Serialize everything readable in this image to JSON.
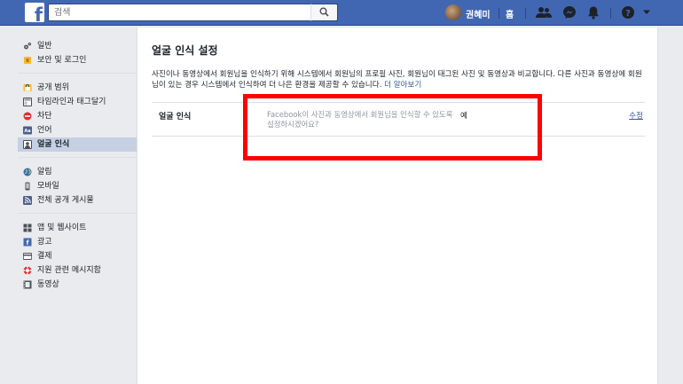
{
  "topbar": {
    "logo": "f",
    "search_placeholder": "검색",
    "user_name": "권혜미",
    "home_label": "홈"
  },
  "sidebar": {
    "groups": [
      {
        "items": [
          {
            "label": "일반",
            "icon": "gears-icon"
          },
          {
            "label": "보안 및 로그인",
            "icon": "shield-icon"
          }
        ]
      },
      {
        "items": [
          {
            "label": "공개 범위",
            "icon": "privacy-lock-icon"
          },
          {
            "label": "타임라인과 태그달기",
            "icon": "timeline-icon"
          },
          {
            "label": "차단",
            "icon": "block-icon"
          },
          {
            "label": "언어",
            "icon": "language-icon"
          },
          {
            "label": "얼굴 인식",
            "icon": "face-recognition-icon",
            "active": true
          }
        ]
      },
      {
        "items": [
          {
            "label": "알림",
            "icon": "globe-icon"
          },
          {
            "label": "모바일",
            "icon": "mobile-icon"
          },
          {
            "label": "전체 공개 게시물",
            "icon": "rss-icon"
          }
        ]
      },
      {
        "items": [
          {
            "label": "앱 및 웹사이트",
            "icon": "apps-icon"
          },
          {
            "label": "광고",
            "icon": "ads-icon"
          },
          {
            "label": "결제",
            "icon": "card-icon"
          },
          {
            "label": "지원 관련 메시지함",
            "icon": "lifebuoy-icon"
          },
          {
            "label": "동영상",
            "icon": "video-icon"
          }
        ]
      }
    ]
  },
  "main": {
    "title": "얼굴 인식 설정",
    "description": "사진이나 동영상에서 회원님을 인식하기 위해 시스템에서 회원님의 프로필 사진, 회원님이 태그된 사진 및 동영상과 비교합니다. 다른 사진과 동영상에 회원님이 있는 경우 시스템에서 인식하여 더 나은 환경을 제공할 수 있습니다.",
    "learn_more": "더 알아보기",
    "setting": {
      "label": "얼굴 인식",
      "question": "Facebook이 사진과 동영상에서 회원님을 인식할 수 있도록 설정하시겠어요?",
      "value": "예",
      "edit_label": "수정"
    }
  },
  "colors": {
    "topbar": "#4267b2",
    "link": "#365899",
    "highlight": "#ff0000",
    "active_nav": "#c5d0e3"
  }
}
